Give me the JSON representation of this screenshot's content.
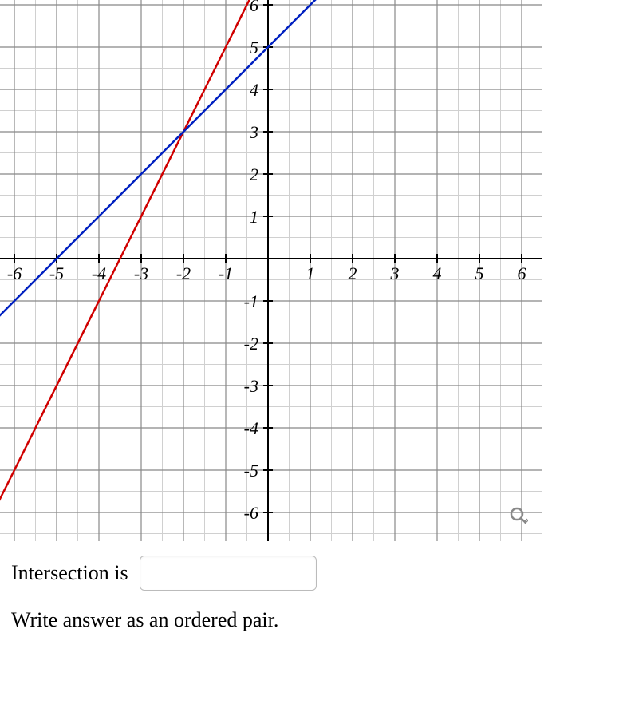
{
  "chart_data": {
    "type": "line",
    "xlim": [
      -6.5,
      6.5
    ],
    "ylim": [
      -6.2,
      6.2
    ],
    "xticks": [
      -6,
      -5,
      -4,
      -3,
      -2,
      -1,
      1,
      2,
      3,
      4,
      5,
      6
    ],
    "yticks": [
      -6,
      -5,
      -4,
      -3,
      -2,
      -1,
      1,
      2,
      3,
      4,
      5,
      6
    ],
    "grid": true,
    "series": [
      {
        "name": "red",
        "color": "#d00000",
        "slope": 2,
        "intercept": 7,
        "points": [
          [
            -6,
            -5
          ],
          [
            -2,
            3
          ],
          [
            0,
            7
          ]
        ]
      },
      {
        "name": "blue",
        "color": "#0020c0",
        "slope": 1,
        "intercept": 5,
        "points": [
          [
            -6,
            -1
          ],
          [
            -2,
            3
          ],
          [
            0,
            5
          ]
        ]
      }
    ],
    "intersection": [
      -2,
      3
    ]
  },
  "form": {
    "prompt_label": "Intersection is",
    "answer_value": "",
    "answer_placeholder": "",
    "instruction": "Write answer as an ordered pair."
  },
  "icons": {
    "zoom": "magnify-icon"
  }
}
